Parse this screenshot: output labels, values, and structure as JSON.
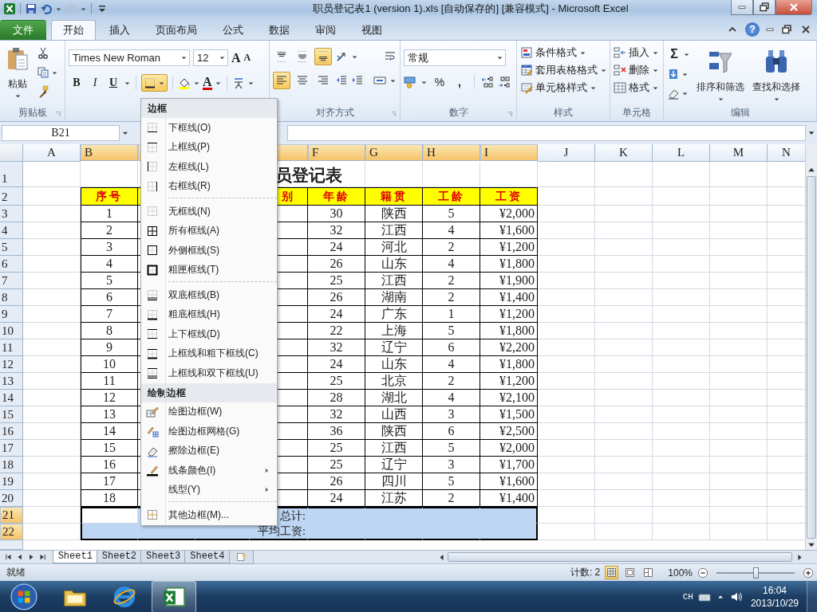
{
  "title_bar": {
    "title": "职员登记表1 (version 1).xls [自动保存的]  [兼容模式]  -  Microsoft Excel"
  },
  "ribbon_tabs": [
    {
      "label": "文件",
      "kind": "file",
      "selected": false
    },
    {
      "label": "开始",
      "kind": "tab",
      "selected": true
    },
    {
      "label": "插入",
      "kind": "tab",
      "selected": false
    },
    {
      "label": "页面布局",
      "kind": "tab",
      "selected": false
    },
    {
      "label": "公式",
      "kind": "tab",
      "selected": false
    },
    {
      "label": "数据",
      "kind": "tab",
      "selected": false
    },
    {
      "label": "审阅",
      "kind": "tab",
      "selected": false
    },
    {
      "label": "视图",
      "kind": "tab",
      "selected": false
    }
  ],
  "help": "?",
  "ribbon": {
    "clipboard": {
      "paste": "粘贴",
      "group": "剪贴板"
    },
    "font": {
      "name": "Times New Roman",
      "size": "12",
      "grow": "A",
      "shrink": "A",
      "bold": "B",
      "italic": "I",
      "underline": "U",
      "borders_pressed": true,
      "font_color": "A"
    },
    "alignment": {
      "group": "对齐方式",
      "vertical": [
        {
          "kind": "top",
          "selected": false
        },
        {
          "kind": "middle",
          "selected": false
        },
        {
          "kind": "bottom",
          "selected": true
        }
      ],
      "horizontal": [
        {
          "kind": "left",
          "selected": true
        },
        {
          "kind": "center",
          "selected": false
        },
        {
          "kind": "right",
          "selected": false
        }
      ]
    },
    "number": {
      "group": "数字",
      "format": "常规",
      "percent": "%",
      "comma": ","
    },
    "styles": {
      "group": "样式",
      "items": [
        {
          "label": "条件格式",
          "kind": "cond"
        },
        {
          "label": "套用表格格式",
          "kind": "table"
        },
        {
          "label": "单元格样式",
          "kind": "cellstyle"
        }
      ]
    },
    "cells": {
      "group": "单元格",
      "items": [
        {
          "label": "插入",
          "kind": "insert"
        },
        {
          "label": "删除",
          "kind": "delete"
        },
        {
          "label": "格式",
          "kind": "format"
        }
      ]
    },
    "editing": {
      "group": "编辑",
      "sigma": "Σ",
      "sort": "排序和筛选",
      "find": "查找和选择"
    }
  },
  "formula_bar": {
    "name_box": "B21"
  },
  "border_menu": {
    "sections": [
      {
        "title": "边框",
        "items": [
          {
            "label": "下框线(O)",
            "kind": "bottom"
          },
          {
            "label": "上框线(P)",
            "kind": "top"
          },
          {
            "label": "左框线(L)",
            "kind": "left"
          },
          {
            "label": "右框线(R)",
            "kind": "right"
          },
          {
            "kind": "separator"
          },
          {
            "label": "无框线(N)",
            "kind": "none"
          },
          {
            "label": "所有框线(A)",
            "kind": "all"
          },
          {
            "label": "外侧框线(S)",
            "kind": "outside"
          },
          {
            "label": "粗匣框线(T)",
            "kind": "thick"
          },
          {
            "kind": "separator"
          },
          {
            "label": "双底框线(B)",
            "kind": "double_bottom"
          },
          {
            "label": "粗底框线(H)",
            "kind": "thick_bottom"
          },
          {
            "label": "上下框线(D)",
            "kind": "top_bottom"
          },
          {
            "label": "上框线和粗下框线(C)",
            "kind": "top_thick_bottom"
          },
          {
            "label": "上框线和双下框线(U)",
            "kind": "top_double_bottom"
          }
        ]
      },
      {
        "title": "绘制边框",
        "items": [
          {
            "label": "绘图边框(W)",
            "kind": "draw"
          },
          {
            "label": "绘图边框网格(G)",
            "kind": "draw_grid"
          },
          {
            "label": "擦除边框(E)",
            "kind": "erase"
          },
          {
            "label": "线条颜色(I)",
            "kind": "line_color",
            "submenu": true
          },
          {
            "label": "线型(Y)",
            "kind": "line_style",
            "submenu": true
          },
          {
            "kind": "separator"
          },
          {
            "label": "其他边框(M)...",
            "kind": "more"
          }
        ]
      }
    ]
  },
  "sheet": {
    "columns": [
      {
        "label": "A",
        "selected": false
      },
      {
        "label": "B",
        "selected": true
      },
      {
        "selected": true
      },
      {
        "selected": true
      },
      {
        "label": "F",
        "selected": true
      },
      {
        "label": "G",
        "selected": true
      },
      {
        "label": "H",
        "selected": true
      },
      {
        "label": "I",
        "selected": true
      },
      {
        "label": "J",
        "selected": false
      },
      {
        "label": "K",
        "selected": false
      },
      {
        "label": "L",
        "selected": false
      },
      {
        "label": "M",
        "selected": false
      },
      {
        "label": "N",
        "selected": false
      }
    ],
    "rows": [
      {
        "label": "1",
        "selected": false,
        "kind": "title",
        "title": "员登记表"
      },
      {
        "label": "2",
        "selected": false,
        "kind": "header",
        "no": "序号",
        "gender": "别",
        "age": "年龄",
        "origin": "籍贯",
        "years": "工龄",
        "salary": "工资"
      },
      {
        "label": "3",
        "selected": false,
        "kind": "data",
        "no": "1",
        "age": "30",
        "origin": "陕西",
        "years": "5",
        "salary": "¥2,000"
      },
      {
        "label": "4",
        "selected": false,
        "kind": "data",
        "no": "2",
        "age": "32",
        "origin": "江西",
        "years": "4",
        "salary": "¥1,600"
      },
      {
        "label": "5",
        "selected": false,
        "kind": "data",
        "no": "3",
        "age": "24",
        "origin": "河北",
        "years": "2",
        "salary": "¥1,200"
      },
      {
        "label": "6",
        "selected": false,
        "kind": "data",
        "no": "4",
        "age": "26",
        "origin": "山东",
        "years": "4",
        "salary": "¥1,800"
      },
      {
        "label": "7",
        "selected": false,
        "kind": "data",
        "no": "5",
        "age": "25",
        "origin": "江西",
        "years": "2",
        "salary": "¥1,900"
      },
      {
        "label": "8",
        "selected": false,
        "kind": "data",
        "no": "6",
        "age": "26",
        "origin": "湖南",
        "years": "2",
        "salary": "¥1,400"
      },
      {
        "label": "9",
        "selected": false,
        "kind": "data",
        "no": "7",
        "age": "24",
        "origin": "广东",
        "years": "1",
        "salary": "¥1,200"
      },
      {
        "label": "10",
        "selected": false,
        "kind": "data",
        "no": "8",
        "age": "22",
        "origin": "上海",
        "years": "5",
        "salary": "¥1,800"
      },
      {
        "label": "11",
        "selected": false,
        "kind": "data",
        "no": "9",
        "age": "32",
        "origin": "辽宁",
        "years": "6",
        "salary": "¥2,200"
      },
      {
        "label": "12",
        "selected": false,
        "kind": "data",
        "no": "10",
        "age": "24",
        "origin": "山东",
        "years": "4",
        "salary": "¥1,800"
      },
      {
        "label": "13",
        "selected": false,
        "kind": "data",
        "no": "11",
        "age": "25",
        "origin": "北京",
        "years": "2",
        "salary": "¥1,200"
      },
      {
        "label": "14",
        "selected": false,
        "kind": "data",
        "no": "12",
        "age": "28",
        "origin": "湖北",
        "years": "4",
        "salary": "¥2,100"
      },
      {
        "label": "15",
        "selected": false,
        "kind": "data",
        "no": "13",
        "age": "32",
        "origin": "山西",
        "years": "3",
        "salary": "¥1,500"
      },
      {
        "label": "16",
        "selected": false,
        "kind": "data",
        "no": "14",
        "age": "36",
        "origin": "陕西",
        "years": "6",
        "salary": "¥2,500"
      },
      {
        "label": "17",
        "selected": false,
        "kind": "data",
        "no": "15",
        "age": "25",
        "origin": "江西",
        "years": "5",
        "salary": "¥2,000"
      },
      {
        "label": "18",
        "selected": false,
        "kind": "data",
        "no": "16",
        "age": "25",
        "origin": "辽宁",
        "years": "3",
        "salary": "¥1,700"
      },
      {
        "label": "19",
        "selected": false,
        "kind": "data",
        "no": "17",
        "age": "26",
        "origin": "四川",
        "years": "5",
        "salary": "¥1,600"
      },
      {
        "label": "20",
        "selected": false,
        "kind": "data",
        "no": "18",
        "age": "24",
        "origin": "江苏",
        "years": "2",
        "salary": "¥1,400"
      },
      {
        "label": "21",
        "selected": true,
        "kind": "summary",
        "text": "总计:",
        "active": true
      },
      {
        "label": "22",
        "selected": true,
        "kind": "summary",
        "text": "平均工资:",
        "active": false
      }
    ]
  },
  "sheet_tabs": [
    {
      "label": "Sheet1",
      "selected": true
    },
    {
      "label": "Sheet2",
      "selected": false
    },
    {
      "label": "Sheet3",
      "selected": false
    },
    {
      "label": "Sheet4",
      "selected": false
    }
  ],
  "status_bar": {
    "status": "就绪",
    "count": "计数: 2",
    "views": [
      {
        "kind": "normal",
        "selected": true
      },
      {
        "kind": "layout",
        "selected": false
      },
      {
        "kind": "break",
        "selected": false
      }
    ],
    "zoom": "100%",
    "zoom_slider": {
      "level": 0.5
    }
  },
  "taskbar": {
    "apps": [
      {
        "kind": "explorer",
        "selected": false
      },
      {
        "kind": "ie",
        "selected": false
      },
      {
        "kind": "excel",
        "selected": true
      }
    ],
    "language": "CH",
    "time": "16:04",
    "date": "2013/10/29"
  }
}
